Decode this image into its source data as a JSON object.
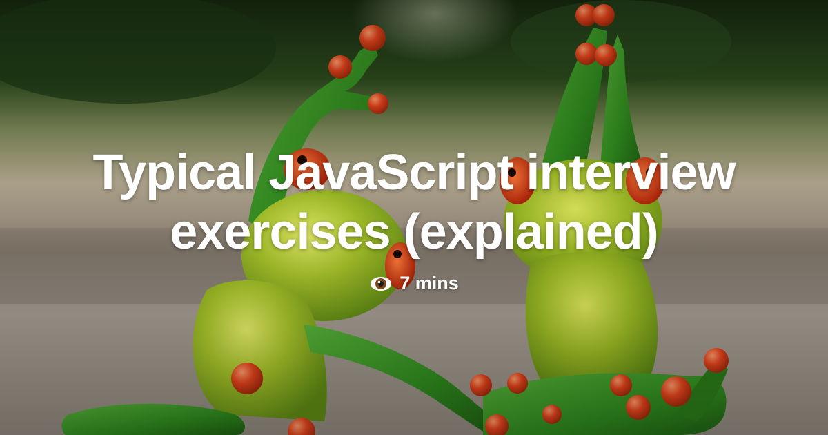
{
  "card": {
    "title": "Typical JavaScript interview exercises (explained)",
    "reading_time": "7 mins",
    "reading_time_icon": "eye-icon"
  },
  "colors": {
    "title_text": "#ffffff",
    "frog_body": "#8fb820",
    "frog_limb": "#2f8a1e",
    "frog_toe": "#e2431c",
    "background_foliage": "#1f3a18",
    "ground": "#9c9588"
  }
}
